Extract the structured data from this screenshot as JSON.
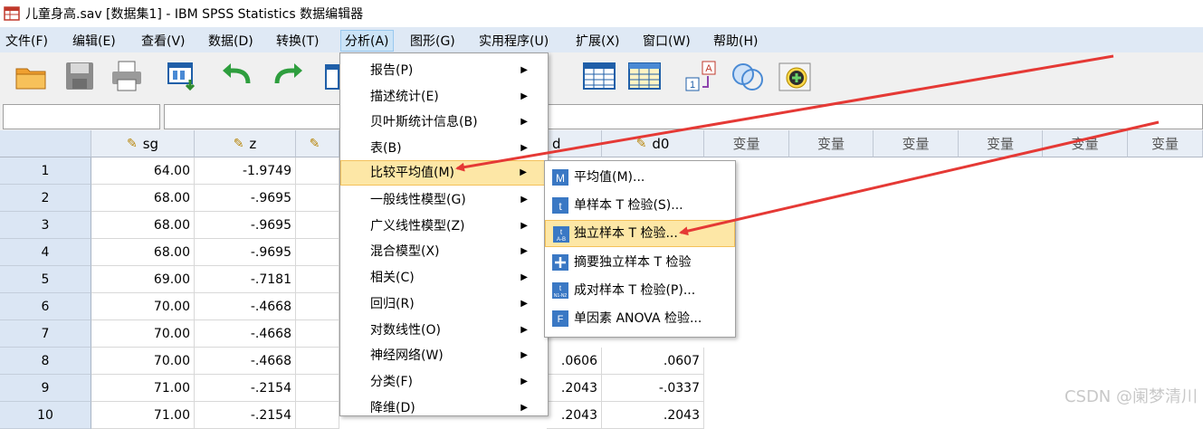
{
  "window": {
    "title": "儿童身高.sav [数据集1] - IBM SPSS Statistics 数据编辑器"
  },
  "menubar": [
    {
      "label": "文件(F)",
      "name": "menu-file"
    },
    {
      "label": "编辑(E)",
      "name": "menu-edit"
    },
    {
      "label": "查看(V)",
      "name": "menu-view"
    },
    {
      "label": "数据(D)",
      "name": "menu-data"
    },
    {
      "label": "转换(T)",
      "name": "menu-transform"
    },
    {
      "label": "分析(A)",
      "name": "menu-analyze"
    },
    {
      "label": "图形(G)",
      "name": "menu-graphs"
    },
    {
      "label": "实用程序(U)",
      "name": "menu-utilities"
    },
    {
      "label": "扩展(X)",
      "name": "menu-extensions"
    },
    {
      "label": "窗口(W)",
      "name": "menu-window"
    },
    {
      "label": "帮助(H)",
      "name": "menu-help"
    }
  ],
  "analyze_menu": [
    "报告(P)",
    "描述统计(E)",
    "贝叶斯统计信息(B)",
    "表(B)",
    "比较平均值(M)",
    "一般线性模型(G)",
    "广义线性模型(Z)",
    "混合模型(X)",
    "相关(C)",
    "回归(R)",
    "对数线性(O)",
    "神经网络(W)",
    "分类(F)",
    "降维(D)"
  ],
  "compare_means_submenu": [
    "平均值(M)...",
    "单样本 T 检验(S)...",
    "独立样本 T 检验...",
    "摘要独立样本 T 检验",
    "成对样本 T 检验(P)...",
    "单因素 ANOVA 检验..."
  ],
  "grid": {
    "columns": [
      "sg",
      "z",
      "d0",
      "变量",
      "变量",
      "变量",
      "变量",
      "变量",
      "变量"
    ],
    "partial_col_label": "d",
    "rows": [
      {
        "n": "1",
        "sg": "64.00",
        "z": "-1.9749"
      },
      {
        "n": "2",
        "sg": "68.00",
        "z": "-.9695"
      },
      {
        "n": "3",
        "sg": "68.00",
        "z": "-.9695"
      },
      {
        "n": "4",
        "sg": "68.00",
        "z": "-.9695"
      },
      {
        "n": "5",
        "sg": "69.00",
        "z": "-.7181"
      },
      {
        "n": "6",
        "sg": "70.00",
        "z": "-.4668"
      },
      {
        "n": "7",
        "sg": "70.00",
        "z": "-.4668"
      },
      {
        "n": "8",
        "sg": "70.00",
        "z": "-.4668",
        "d": ".0606",
        "d0": ".0607"
      },
      {
        "n": "9",
        "sg": "71.00",
        "z": "-.2154",
        "d": ".2043",
        "d0": "-.0337"
      },
      {
        "n": "10",
        "sg": "71.00",
        "z": "-.2154",
        "d": ".2043",
        "d0": ".2043"
      }
    ]
  },
  "watermark": "CSDN @阑梦清川",
  "colors": {
    "highlight": "#fde7a6",
    "menubar": "#dfe9f5",
    "arrow": "#e53935"
  }
}
